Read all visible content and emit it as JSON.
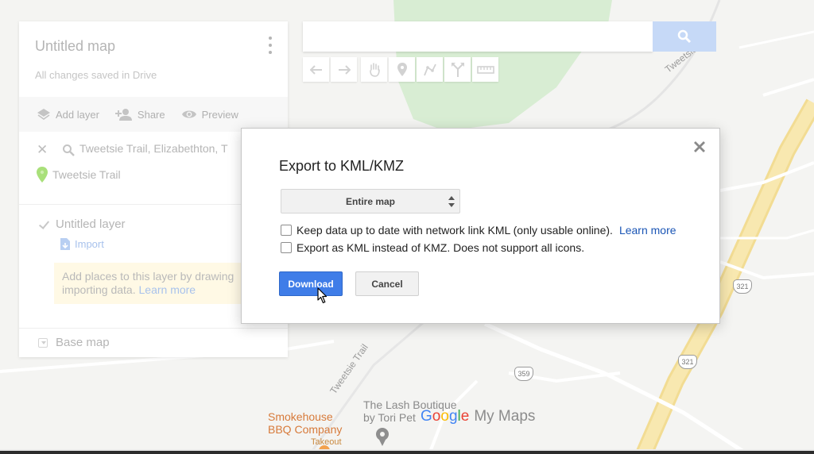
{
  "map": {
    "trail_label_top": "Tweetsie Trail",
    "trail_label_bottom": "Tweetsie Trail",
    "route_321_a": "321",
    "route_321_b": "321",
    "route_359": "359",
    "poi_smokehouse_line1": "Smokehouse",
    "poi_smokehouse_line2": "BBQ Company",
    "poi_smokehouse_sub": "Takeout",
    "poi_lash_line1": "The Lash Boutique",
    "poi_lash_line2": "by Tori Pet",
    "watermark_google": [
      "G",
      "o",
      "o",
      "g",
      "l",
      "e"
    ],
    "watermark_product": "My Maps",
    "colors": {
      "park": "#d8edd3",
      "highway": "#f6e3a0",
      "road": "#ffffff"
    }
  },
  "search": {
    "placeholder": "",
    "button_icon": "search-icon"
  },
  "toolbar": {
    "tools": [
      "undo-icon",
      "redo-icon",
      "hand-icon",
      "marker-icon",
      "line-icon",
      "directions-icon",
      "ruler-icon"
    ]
  },
  "panel": {
    "title": "Untitled map",
    "subtitle": "All changes saved in Drive",
    "actions": [
      {
        "icon": "layers-icon",
        "label": "Add layer"
      },
      {
        "icon": "add-person-icon",
        "label": "Share"
      },
      {
        "icon": "eye-icon",
        "label": "Preview"
      }
    ],
    "search_query": "Tweetsie Trail, Elizabethton, T",
    "result_label": "Tweetsie Trail",
    "layer_name": "Untitled layer",
    "import_label": "Import",
    "hint_text": "Add places to this layer by drawing or importing data. ",
    "hint_link": "Learn more",
    "hint_line1": "Add places to this layer by drawing",
    "hint_line2": "importing data.",
    "base_map_label": "Base map"
  },
  "dialog": {
    "title": "Export to KML/KMZ",
    "select_value": "Entire map",
    "options": [
      {
        "label": "Keep data up to date with network link KML (only usable online).",
        "link": "Learn more",
        "checked": false
      },
      {
        "label": "Export as KML instead of KMZ. Does not support all icons.",
        "checked": false
      }
    ],
    "download_label": "Download",
    "cancel_label": "Cancel",
    "accent_color": "#3f7de8"
  }
}
